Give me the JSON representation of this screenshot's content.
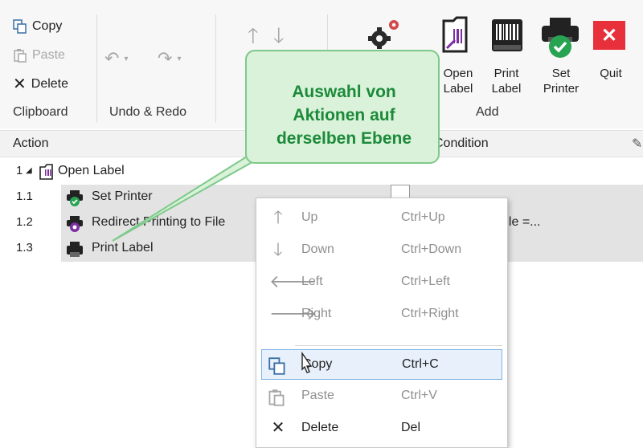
{
  "ribbon": {
    "clipboard": {
      "copy": "Copy",
      "paste": "Paste",
      "delete": "Delete",
      "group": "Clipboard"
    },
    "undo": {
      "group": "Undo & Redo"
    },
    "add": {
      "open_label": [
        "Open",
        "Label"
      ],
      "print_label": [
        "Print",
        "Label"
      ],
      "set_printer": [
        "Set",
        "Printer"
      ],
      "group": "Add"
    },
    "quit": "Quit"
  },
  "columns": {
    "action": "Action",
    "condition": "Condition"
  },
  "tree": [
    {
      "num": "1",
      "label": "Open Label"
    },
    {
      "num": "1.1",
      "label": "Set Printer"
    },
    {
      "num": "1.2",
      "label": "Redirect Printing to File",
      "condition": "n_PrintToFile =..."
    },
    {
      "num": "1.3",
      "label": "Print Label"
    }
  ],
  "callout": {
    "lines": [
      "Auswahl von",
      "Aktionen auf",
      "derselben Ebene"
    ]
  },
  "menu": {
    "items": [
      {
        "label": "Up",
        "shortcut": "Ctrl+Up",
        "icon": "arrow-up-icon"
      },
      {
        "label": "Down",
        "shortcut": "Ctrl+Down",
        "icon": "arrow-down-icon"
      },
      {
        "label": "Left",
        "shortcut": "Ctrl+Left",
        "icon": "arrow-left-icon"
      },
      {
        "label": "Right",
        "shortcut": "Ctrl+Right",
        "icon": "arrow-right-icon"
      },
      {
        "label": "Copy",
        "shortcut": "Ctrl+C",
        "icon": "copy-icon"
      },
      {
        "label": "Paste",
        "shortcut": "Ctrl+V",
        "icon": "paste-icon"
      },
      {
        "label": "Delete",
        "shortcut": "Del",
        "icon": "delete-icon"
      }
    ]
  },
  "colors": {
    "quit_red": "#e8303a",
    "accent_green": "#1c8a3a",
    "callout_bg": "#d9f2d9",
    "printer_check_green": "#27a352",
    "purple_icon": "#7b2fa0"
  }
}
